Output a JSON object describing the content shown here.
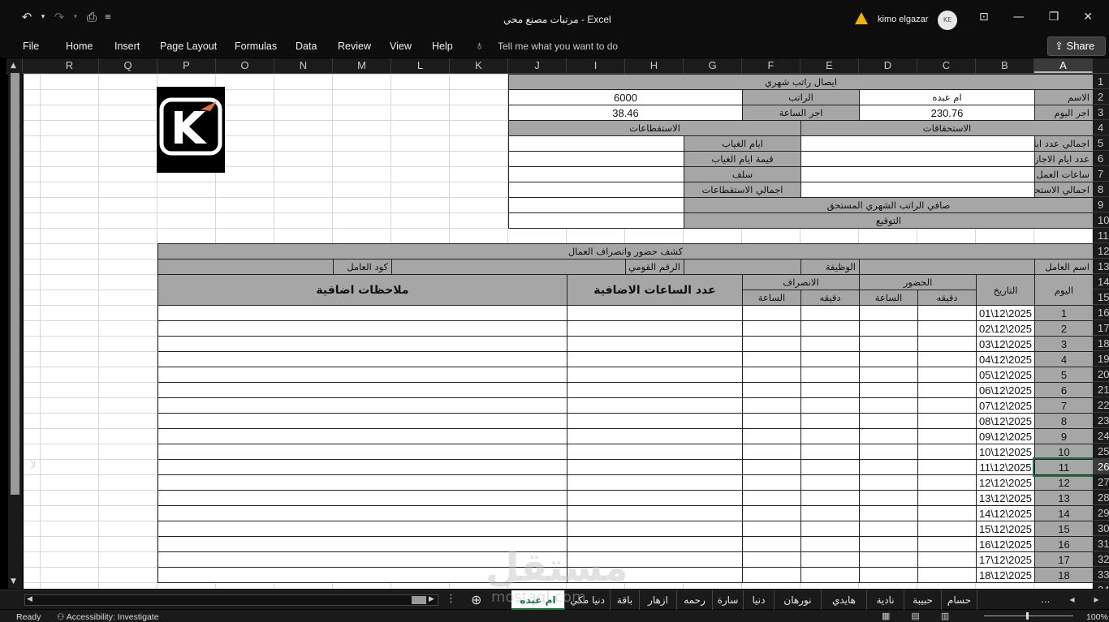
{
  "window": {
    "title": "مرتبات مصنع محي  -  Excel",
    "user": "kimo elgazar",
    "avatar_initials": "KE"
  },
  "ribbon": {
    "tabs": [
      "File",
      "Home",
      "Insert",
      "Page Layout",
      "Formulas",
      "Data",
      "Review",
      "View",
      "Help"
    ],
    "tell_me": "Tell me what you want to do",
    "share": "Share"
  },
  "columns": [
    "A",
    "B",
    "C",
    "D",
    "E",
    "F",
    "G",
    "H",
    "I",
    "J",
    "K",
    "L",
    "M",
    "N",
    "O",
    "P",
    "Q",
    "R"
  ],
  "active_column": "A",
  "rows": [
    "1",
    "2",
    "3",
    "4",
    "5",
    "6",
    "7",
    "8",
    "9",
    "10",
    "11",
    "12",
    "13",
    "14",
    "15",
    "16",
    "17",
    "18",
    "19",
    "20",
    "21",
    "22",
    "23",
    "24",
    "25",
    "26",
    "27",
    "28",
    "29",
    "30",
    "31",
    "32",
    "33",
    "34"
  ],
  "active_row": "26",
  "receipt": {
    "title": "ايصال راتب شهري",
    "name_label": "الاسم",
    "name_value": "ام عبده",
    "salary_label": "الراتب",
    "salary_value": "6000",
    "day_wage_label": "اجر اليوم",
    "day_wage_value": "230.76",
    "hour_wage_label": "اجر الساعة",
    "hour_wage_value": "38.46",
    "entitlements_header": "الاستحقاقات",
    "deductions_header": "الاستقطاعات",
    "entitlements": [
      "اجمالي عدد ايام الحضور",
      "عدد ايام الاجازات الرسمية",
      "ساعات العمل الاضافية",
      "اجمالي الاستحقاقات"
    ],
    "deductions": [
      "ايام الغياب",
      "قيمة ايام الغياب",
      "سلف",
      "اجمالي الاستقطاعات"
    ],
    "net_salary": "صافي الراتب الشهري المستحق",
    "signature": "التوقيع"
  },
  "attendance": {
    "title": "كشف حضور وانصراف العمال",
    "worker_name_label": "اسم العامل",
    "job_label": "الوظيفة",
    "national_id_label": "الرقم القومي",
    "worker_code_label": "كود  العامل",
    "day_header": "اليوم",
    "date_header": "التاريخ",
    "check_in_header": "الحضور",
    "check_out_header": "الانصراف",
    "minute_header": "دقيقه",
    "hour_header": "الساعة",
    "extra_hours_header": "عدد الساعات الاضافية",
    "notes_header": "ملاحظات اضافية",
    "days": [
      "1",
      "2",
      "3",
      "4",
      "5",
      "6",
      "7",
      "8",
      "9",
      "10",
      "11",
      "12",
      "13",
      "14",
      "15",
      "16",
      "17",
      "18"
    ],
    "dates": [
      "01\\12\\2025",
      "02\\12\\2025",
      "03\\12\\2025",
      "04\\12\\2025",
      "05\\12\\2025",
      "06\\12\\2025",
      "07\\12\\2025",
      "08\\12\\2025",
      "09\\12\\2025",
      "10\\12\\2025",
      "11\\12\\2025",
      "12\\12\\2025",
      "13\\12\\2025",
      "14\\12\\2025",
      "15\\12\\2025",
      "16\\12\\2025",
      "17\\12\\2025",
      "18\\12\\2025"
    ]
  },
  "side_mark": "لأ",
  "sheet_tabs": [
    "ام عبده",
    "دنيا مكي",
    "باقة",
    "ازهار",
    "رحمه",
    "سارة",
    "دنيا",
    "نورهان",
    "هايدي",
    "نادية",
    "حبيبة",
    "حسام"
  ],
  "active_sheet": "ام عبده",
  "tab_more": "...",
  "status": {
    "ready": "Ready",
    "accessibility": "Accessibility: Investigate",
    "zoom": "100%"
  },
  "watermark": {
    "main": "مستقل",
    "sub": "mostaql.com"
  }
}
